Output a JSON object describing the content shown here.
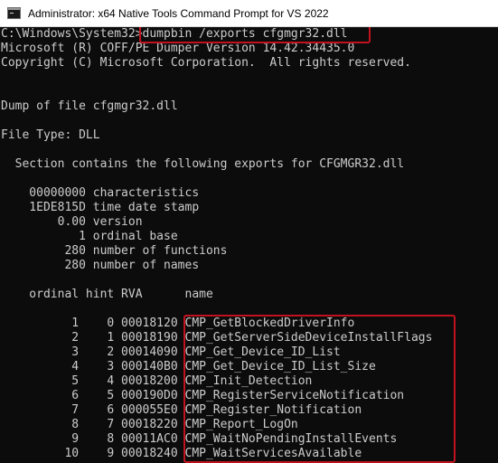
{
  "window": {
    "title": "Administrator: x64 Native Tools Command Prompt for VS 2022",
    "icon": "console-window-icon"
  },
  "console": {
    "lines": [
      "C:\\Windows\\System32>dumpbin /exports cfgmgr32.dll",
      "Microsoft (R) COFF/PE Dumper Version 14.42.34435.0",
      "Copyright (C) Microsoft Corporation.  All rights reserved.",
      "",
      "",
      "Dump of file cfgmgr32.dll",
      "",
      "File Type: DLL",
      "",
      "  Section contains the following exports for CFGMGR32.dll",
      "",
      "    00000000 characteristics",
      "    1EDE815D time date stamp",
      "        0.00 version",
      "           1 ordinal base",
      "         280 number of functions",
      "         280 number of names",
      "",
      "    ordinal hint RVA      name",
      "",
      "          1    0 00018120 CMP_GetBlockedDriverInfo",
      "          2    1 00018190 CMP_GetServerSideDeviceInstallFlags",
      "          3    2 00014090 CMP_Get_Device_ID_List",
      "          4    3 000140B0 CMP_Get_Device_ID_List_Size",
      "          5    4 00018200 CMP_Init_Detection",
      "          6    5 000190D0 CMP_RegisterServiceNotification",
      "          7    6 000055E0 CMP_Register_Notification",
      "          8    7 00018220 CMP_Report_LogOn",
      "          9    8 00011AC0 CMP_WaitNoPendingInstallEvents",
      "         10    9 00018240 CMP_WaitServicesAvailable"
    ]
  },
  "highlight_color": "#c1121f"
}
